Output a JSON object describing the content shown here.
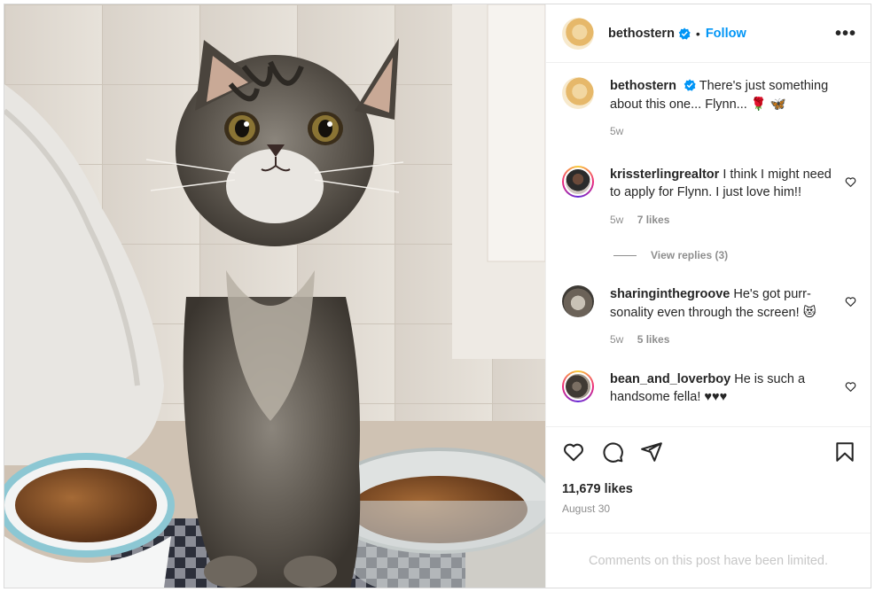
{
  "post": {
    "username": "bethostern",
    "follow_label": "Follow",
    "separator": "•",
    "more_label": "•••"
  },
  "caption": {
    "username": "bethostern",
    "text": "There's just something about this one... Flynn... 🌹 🦋",
    "time": "5w"
  },
  "comments": [
    {
      "username": "krissterlingrealtor",
      "text": "I think I might need to apply for Flynn. I just love him!!",
      "time": "5w",
      "likes": "7 likes",
      "view_replies": "View replies (3)"
    },
    {
      "username": "sharinginthegroove",
      "text": "He's got purr-sonality even through the screen! 😻",
      "time": "5w",
      "likes": "5 likes"
    },
    {
      "username": "bean_and_loverboy",
      "text": "He is such a handsome fella! ♥♥♥"
    }
  ],
  "footer": {
    "likes_total": "11,679 likes",
    "date": "August 30",
    "limited_notice": "Comments on this post have been limited."
  },
  "icons": {
    "verified": "verified-badge-icon",
    "like": "heart-icon",
    "comment": "comment-icon",
    "share": "share-icon",
    "save": "bookmark-icon",
    "more": "more-options-icon"
  },
  "colors": {
    "follow": "#0095f6",
    "verified": "#0095f6",
    "muted": "#8e8e8e",
    "limited": "#c7c7c7"
  },
  "image": {
    "subject": "tabby kitten between two food bowls"
  }
}
